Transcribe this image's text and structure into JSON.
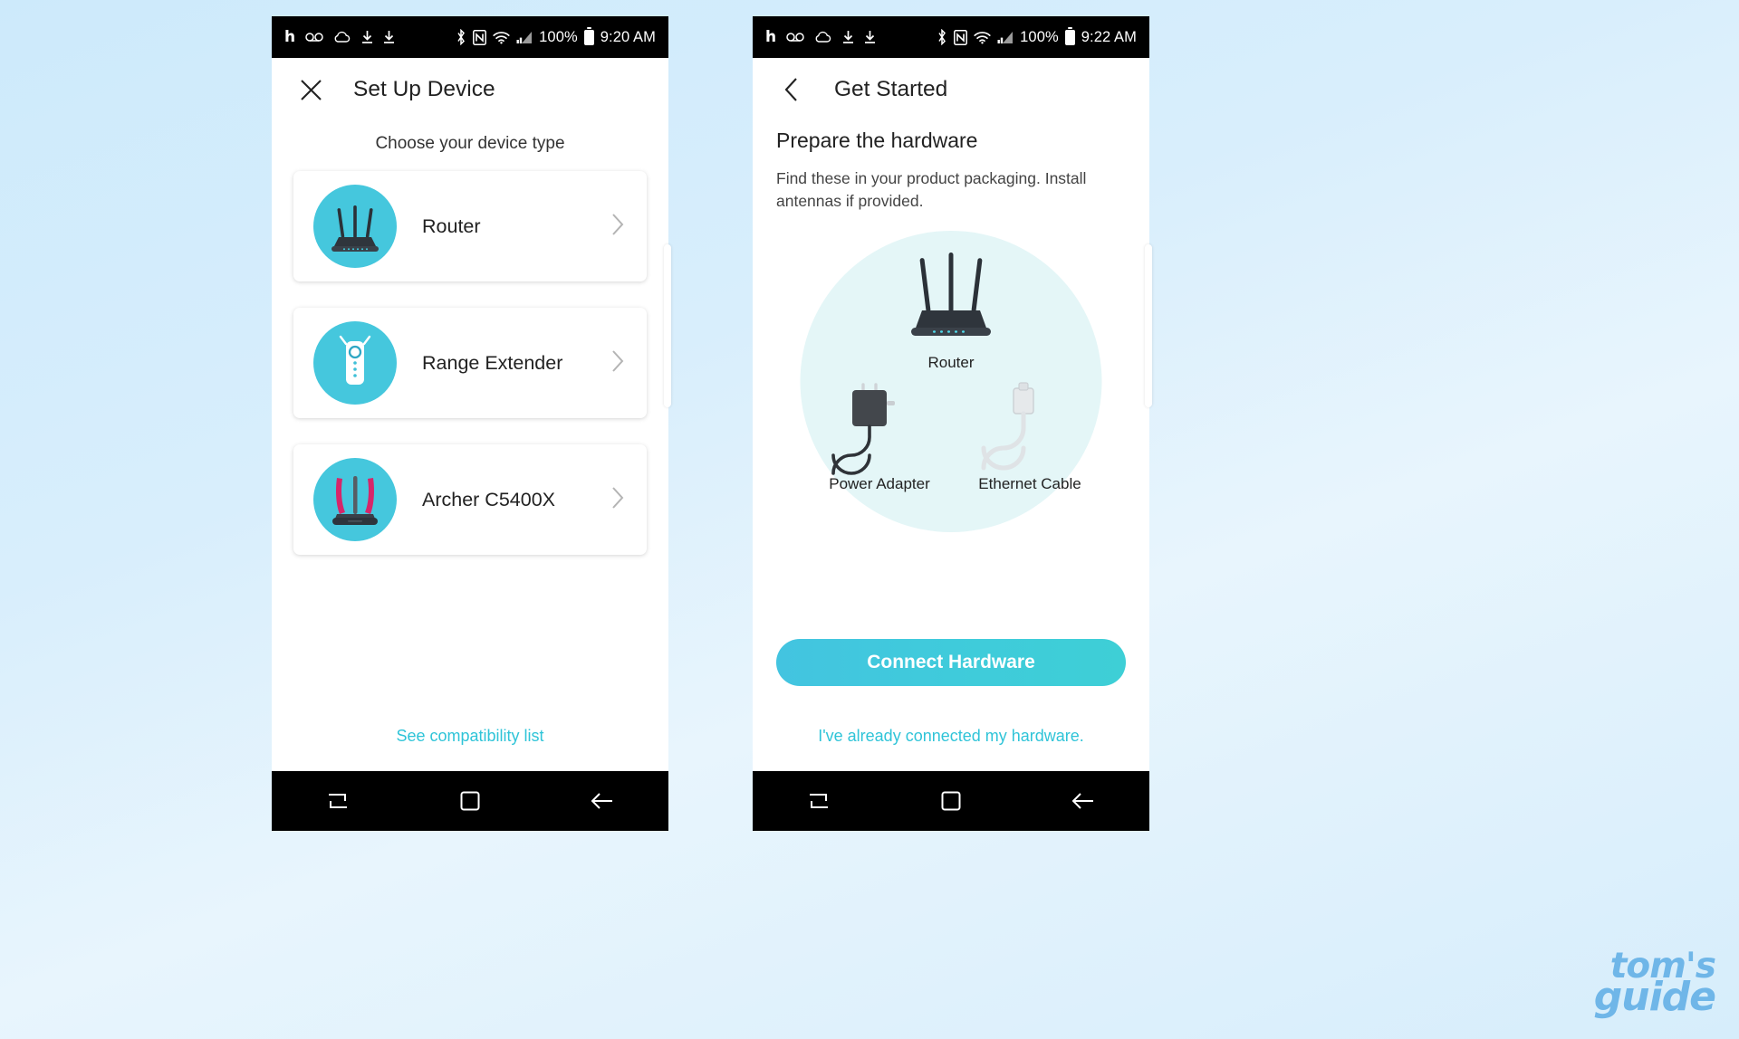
{
  "watermark": {
    "line1": "tom's",
    "line2": "guide"
  },
  "phone_left": {
    "statusbar": {
      "left_icons": [
        "nytimes-icon",
        "voicemail-icon",
        "cloud-icon",
        "download-icon",
        "download-icon"
      ],
      "right_icons": [
        "bluetooth-icon",
        "nfc-icon",
        "wifi-icon",
        "cellular-signal-icon"
      ],
      "battery_text": "100%",
      "time": "9:20 AM"
    },
    "header": {
      "close_icon": "close-icon",
      "title": "Set Up Device"
    },
    "subtitle": "Choose your device type",
    "devices": [
      {
        "label": "Router",
        "icon": "router-icon",
        "chevron": "chevron-right-icon"
      },
      {
        "label": "Range Extender",
        "icon": "range-extender-icon",
        "chevron": "chevron-right-icon"
      },
      {
        "label": "Archer C5400X",
        "icon": "archer-c5400x-icon",
        "chevron": "chevron-right-icon"
      }
    ],
    "compat_link": "See compatibility list",
    "navbar": [
      "recents-icon",
      "home-icon",
      "back-icon"
    ]
  },
  "phone_right": {
    "statusbar": {
      "left_icons": [
        "nytimes-icon",
        "voicemail-icon",
        "cloud-icon",
        "download-icon",
        "download-icon"
      ],
      "right_icons": [
        "bluetooth-icon",
        "nfc-icon",
        "wifi-icon",
        "cellular-signal-icon"
      ],
      "battery_text": "100%",
      "time": "9:22 AM"
    },
    "header": {
      "back_icon": "chevron-left-icon",
      "title": "Get Started"
    },
    "heading": "Prepare the hardware",
    "paragraph": "Find these in your product packaging. Install antennas if provided.",
    "hardware": [
      {
        "label": "Router",
        "icon": "router-illustration"
      },
      {
        "label": "Power Adapter",
        "icon": "power-adapter-illustration"
      },
      {
        "label": "Ethernet Cable",
        "icon": "ethernet-cable-illustration"
      }
    ],
    "primary_button": "Connect Hardware",
    "secondary_link": "I've already connected my hardware.",
    "navbar": [
      "recents-icon",
      "home-icon",
      "back-icon"
    ]
  },
  "colors": {
    "accent_teal": "#3ecfd6",
    "icon_circle": "#45c7dd",
    "link_teal": "#2fc4d8",
    "hw_circle_bg": "#e4f6f7",
    "page_bg": "#cdeafb",
    "watermark": "#6fb6e8"
  }
}
